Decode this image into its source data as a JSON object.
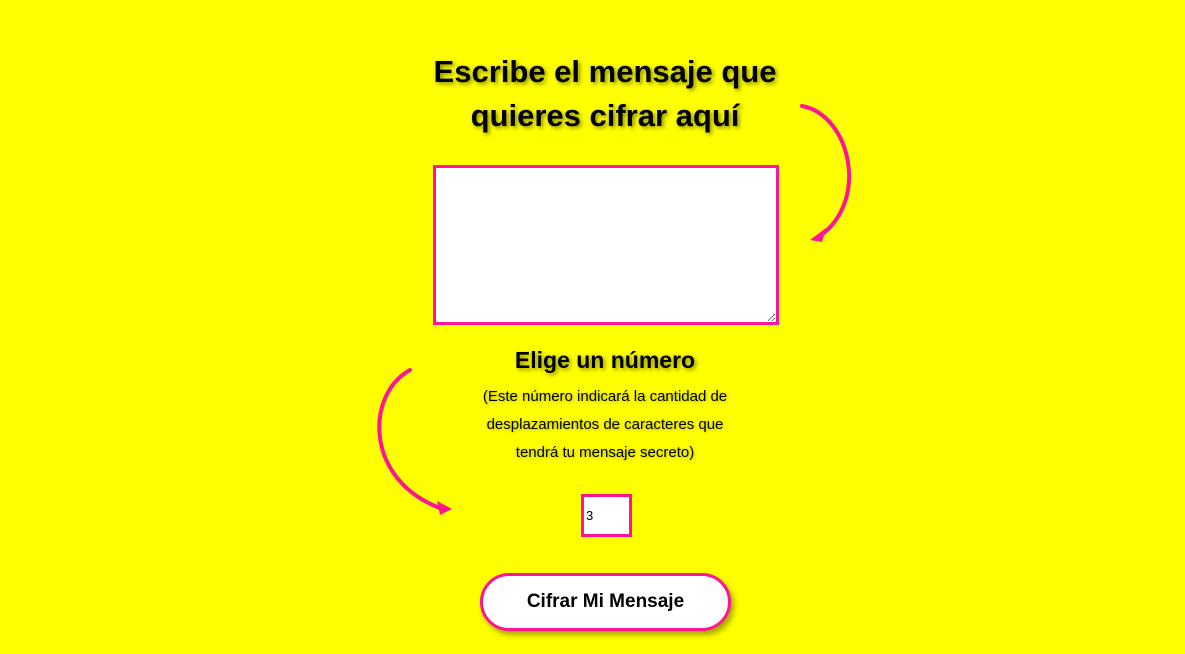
{
  "heading": {
    "line1": "Escribe el mensaje que",
    "line2": "quieres cifrar aquí"
  },
  "message": {
    "value": "",
    "placeholder": ""
  },
  "shift": {
    "title": "Elige un número",
    "hint_line1": "(Este número indicará la cantidad de",
    "hint_line2": "desplazamientos de caracteres que",
    "hint_line3": "tendrá tu mensaje secreto)",
    "value": "3"
  },
  "actions": {
    "encrypt_label": "Cifrar Mi Mensaje"
  },
  "colors": {
    "background": "#ffff00",
    "accent": "#ff1493"
  },
  "icons": {
    "arrow_top": "curved-arrow-icon",
    "arrow_left": "curved-arrow-icon"
  }
}
